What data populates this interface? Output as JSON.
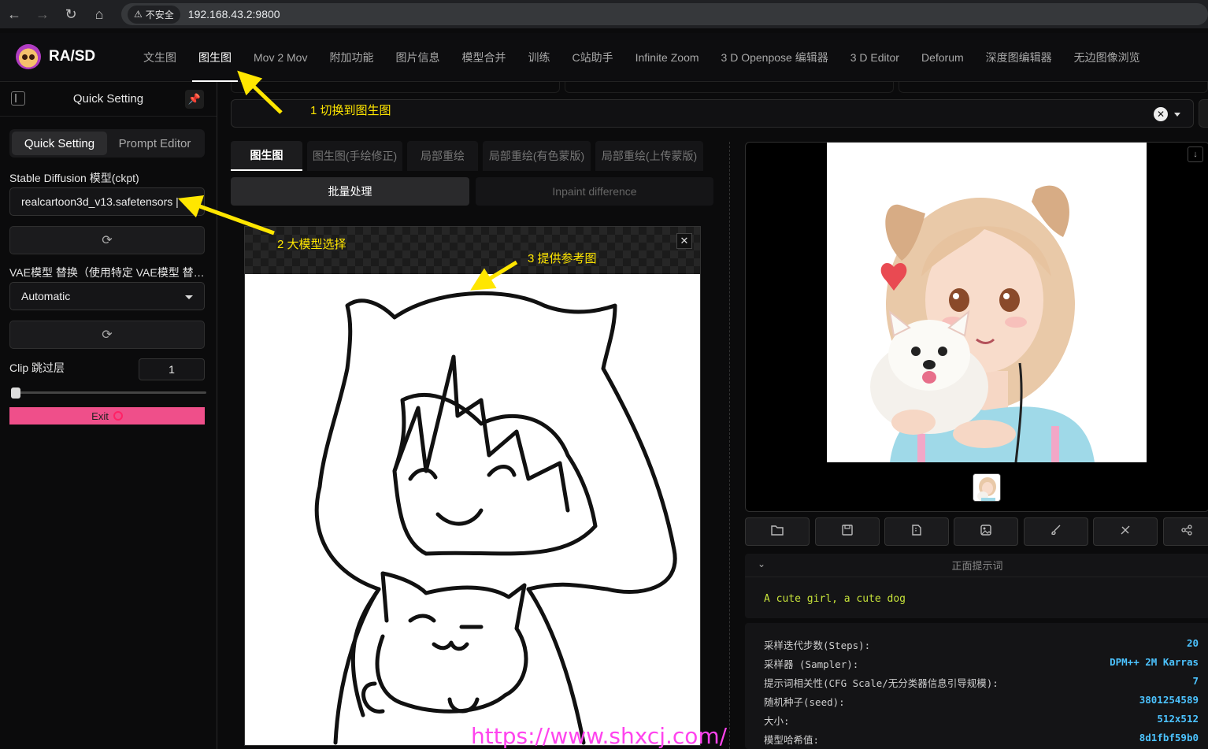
{
  "browser": {
    "insecure_label": "不安全",
    "url": "192.168.43.2:9800"
  },
  "app": {
    "logo_text": "RA/SD",
    "tabs": [
      {
        "label": "文生图"
      },
      {
        "label": "图生图"
      },
      {
        "label": "Mov 2 Mov"
      },
      {
        "label": "附加功能"
      },
      {
        "label": "图片信息"
      },
      {
        "label": "模型合并"
      },
      {
        "label": "训练"
      },
      {
        "label": "C站助手"
      },
      {
        "label": "Infinite Zoom"
      },
      {
        "label": "3 D Openpose 编辑器"
      },
      {
        "label": "3 D Editor"
      },
      {
        "label": "Deforum"
      },
      {
        "label": "深度图编辑器"
      },
      {
        "label": "无边图像浏览"
      }
    ],
    "active_tab": "图生图"
  },
  "sidebar": {
    "title": "Quick Setting",
    "segments": [
      "Quick Setting",
      "Prompt Editor"
    ],
    "ckpt_label": "Stable Diffusion 模型(ckpt)",
    "ckpt_value": "realcartoon3d_v13.safetensors |",
    "vae_label": "VAE模型 替换（使用特定 VAE模型 替换原有 VAE）",
    "vae_value": "Automatic",
    "clip_label": "Clip 跳过层",
    "clip_value": "1",
    "clip_slider_fraction": 0.0,
    "exit_label": "Exit"
  },
  "img2img": {
    "subtabs": [
      "图生图",
      "图生图(手绘修正)",
      "局部重绘",
      "局部重绘(有色蒙版)",
      "局部重绘(上传蒙版)"
    ],
    "mode_tabs": [
      "批量处理",
      "Inpaint difference"
    ]
  },
  "output": {
    "section_title": "正面提示词",
    "prompt": "A cute girl, a cute dog",
    "params": [
      {
        "key": "采样迭代步数(Steps):",
        "value": "20"
      },
      {
        "key": "采样器 (Sampler):",
        "value": "DPM++ 2M Karras"
      },
      {
        "key": "提示词相关性(CFG Scale/无分类器信息引导规模):",
        "value": "7"
      },
      {
        "key": "随机种子(seed):",
        "value": "3801254589"
      },
      {
        "key": "大小:",
        "value": "512x512"
      },
      {
        "key": "模型哈希值:",
        "value": "8d1fbf59b0"
      }
    ]
  },
  "annotations": {
    "a1": "1 切换到图生图",
    "a2": "2 大模型选择",
    "a3": "3 提供参考图"
  },
  "watermark": "https://www.shxcj.com/",
  "colors": {
    "exit": "#ef4f8a",
    "annotation": "#ffe600",
    "param_value": "#4cc3ff",
    "prompt_text": "#c6e23a"
  }
}
